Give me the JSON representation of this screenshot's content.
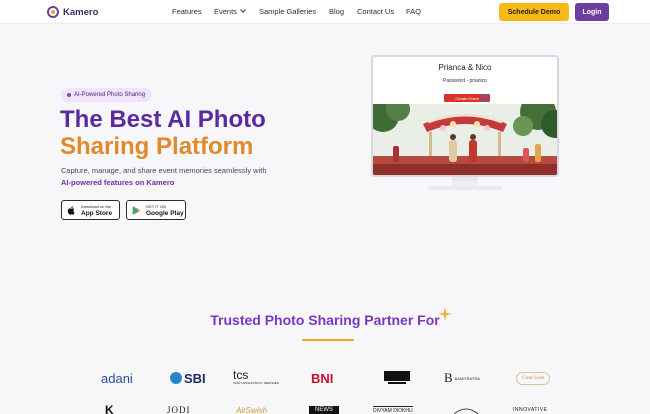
{
  "brand": {
    "name": "Kamero"
  },
  "nav": {
    "features": "Features",
    "events": "Events",
    "galleries": "Sample Galleries",
    "blog": "Blog",
    "contact": "Contact Us",
    "faq": "FAQ",
    "demo_button": "Schedule Demo",
    "login_button": "Login"
  },
  "hero": {
    "badge": "AI-Powered Photo Sharing",
    "title_line1": "The Best AI Photo",
    "title_line2": "Sharing Platform",
    "subtitle": "Capture, manage, and share event memories seamlessly with",
    "subtitle_highlight": "AI-powered features on Kamero",
    "appstore_small": "Download on the",
    "appstore_big": "App Store",
    "googleplay_small": "GET IT ON",
    "googleplay_big": "Google Play"
  },
  "preview": {
    "title": "Prianca & Nico",
    "password": "Password - prianico",
    "button": "Create Event"
  },
  "partners": {
    "heading": "Trusted Photo Sharing Partner For",
    "row1": [
      "adani",
      "SBI",
      "tcs",
      "BNI",
      "BAMITBATRA",
      "Clear Love"
    ],
    "tcs_sub": "TATA CONSULTANCY SERVICES",
    "row2": [
      "JODI",
      "AirSwish",
      "NEWS",
      "DIVYAM DIOKHU",
      "INNOVATIVE"
    ]
  },
  "colors": {
    "brand_purple": "#6b3fa0",
    "accent_yellow": "#f5b919",
    "title_orange": "#e08a2b"
  }
}
